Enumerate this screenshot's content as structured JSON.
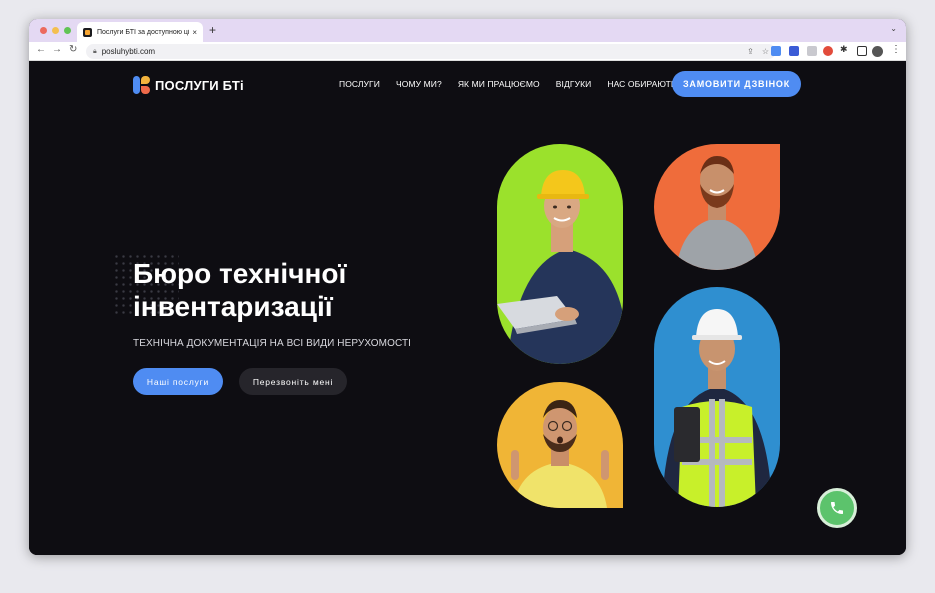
{
  "browser": {
    "tab_title": "Послуги БТІ за доступною ціною",
    "tab_close": "×",
    "new_tab": "+",
    "url": "posluhybti.com",
    "icons": [
      "back-icon",
      "forward-icon",
      "reload-icon",
      "lock-icon",
      "share-icon",
      "star-icon",
      "extension-icon",
      "profile-icon",
      "menu-icon"
    ]
  },
  "header": {
    "logo_text": "ПОСЛУГИ БТі",
    "nav": [
      "ПОСЛУГИ",
      "ЧОМУ МИ?",
      "ЯК МИ ПРАЦЮЄМО",
      "ВІДГУКИ",
      "НАС ОБИРАЮТЬ"
    ],
    "cta": "ЗАМОВИТИ ДЗВІНОК"
  },
  "hero": {
    "title_line1": "Бюро технічної",
    "title_line2": "інвентаризації",
    "subtitle": "ТЕХНІЧНА ДОКУМЕНТАЦІЯ НА ВСІ ВИДИ НЕРУХОМОСТІ",
    "primary_button": "Наші послуги",
    "secondary_button": "Перезвоніть мені"
  },
  "colors": {
    "accent": "#4f8cf2",
    "background": "#0e0d12",
    "photo_green": "#9be12c",
    "photo_orange": "#ef6c3b",
    "photo_blue": "#2f8fd0",
    "photo_yellow": "#f0b536",
    "phone_green": "#5cc36c"
  }
}
